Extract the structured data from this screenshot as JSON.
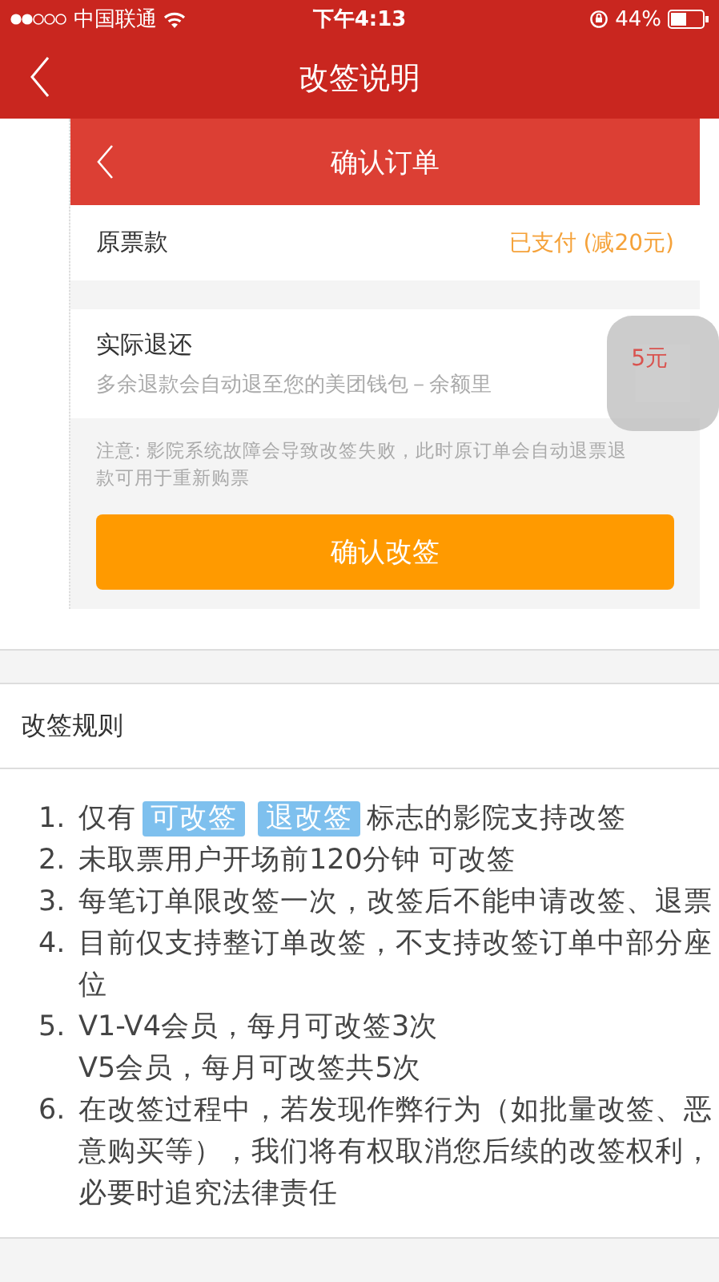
{
  "status_bar": {
    "carrier": "中国联通",
    "time": "下午4:13",
    "battery": "44%"
  },
  "nav": {
    "title": "改签说明"
  },
  "example": {
    "header_title": "确认订单",
    "original_payment": {
      "label": "原票款",
      "value": "已支付 (减20元)"
    },
    "refund": {
      "label": "实际退还",
      "note": "多余退款会自动退至您的美团钱包－余额里",
      "value": "5元"
    },
    "notice": "注意: 影院系统故障会导致改签失败，此时原订单会自动退票退款可用于重新购票",
    "confirm_button": "确认改签"
  },
  "rules": {
    "title": "改签规则",
    "items": [
      {
        "number": "1.",
        "segments": [
          {
            "kind": "text",
            "text": "仅有"
          },
          {
            "kind": "tag",
            "text": "可改签"
          },
          {
            "kind": "tag",
            "text": "退改签"
          },
          {
            "kind": "text",
            "text": "标志的影院支持改签"
          }
        ]
      },
      {
        "number": "2.",
        "segments": [
          {
            "kind": "text",
            "text": "未取票用户开场前120分钟 可改签"
          }
        ]
      },
      {
        "number": "3.",
        "segments": [
          {
            "kind": "text",
            "text": "每笔订单限改签一次，改签后不能申请改签、退票"
          }
        ]
      },
      {
        "number": "4.",
        "segments": [
          {
            "kind": "text",
            "text": "目前仅支持整订单改签，不支持改签订单中部分座位"
          }
        ]
      },
      {
        "number": "5.",
        "segments": [
          {
            "kind": "line",
            "text": "V1-V4会员，每月可改签3次"
          },
          {
            "kind": "line",
            "text": "V5会员，每月可改签共5次"
          }
        ]
      },
      {
        "number": "6.",
        "segments": [
          {
            "kind": "text",
            "text": "在改签过程中，若发现作弊行为（如批量改签、恶意购买等），我们将有权取消您后续的改签权利，必要时追究法律责任"
          }
        ]
      }
    ]
  }
}
